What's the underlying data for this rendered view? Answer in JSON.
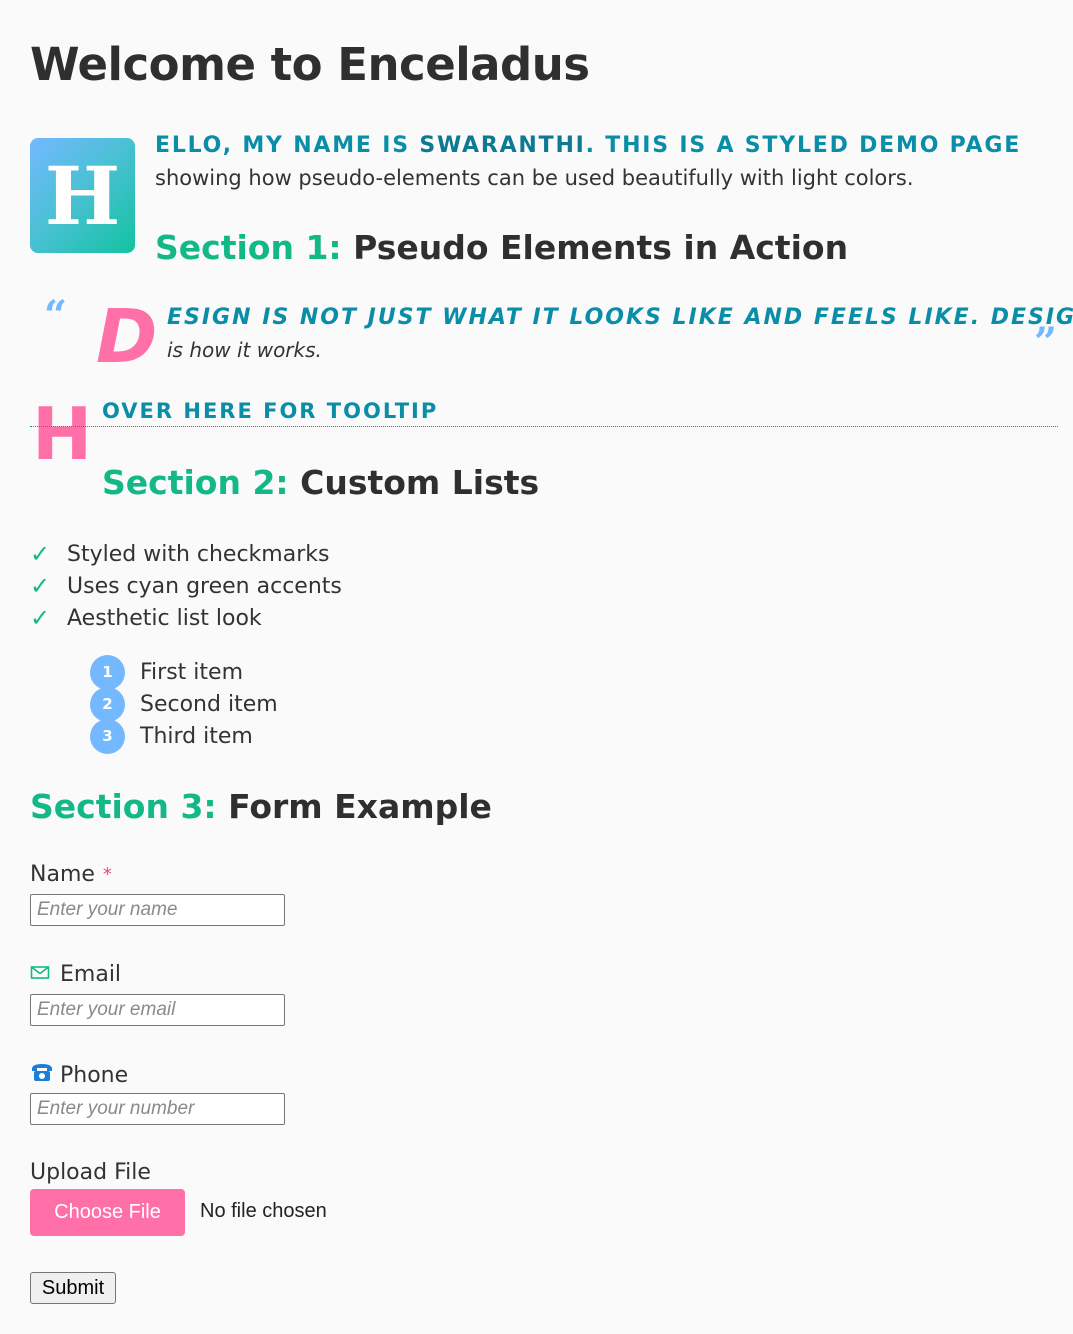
{
  "page": {
    "title": "Welcome to Enceladus"
  },
  "intro": {
    "dropcap": "H",
    "line1_a": "ello, my name is ",
    "line1_name": "Swaranthi",
    "line1_b": ". This is a styled demo page",
    "line2": "showing how pseudo-elements can be used beautifully with light colors."
  },
  "section1": {
    "number": "Section 1:",
    "title": "Pseudo Elements in Action"
  },
  "quote": {
    "open_mark": "“",
    "close_mark": "”",
    "dropcap": "D",
    "line1": "ESIGN IS NOT JUST WHAT IT LOOKS LIKE AND FEELS LIKE. DESIGN",
    "line2": "is how it works."
  },
  "tooltip": {
    "dropcap": "H",
    "text": "OVER HERE FOR TOOLTIP"
  },
  "section2": {
    "number": "Section 2:",
    "title": "Custom Lists"
  },
  "check_list": {
    "mark": "✓",
    "items": [
      "Styled with checkmarks",
      "Uses cyan green accents",
      "Aesthetic list look"
    ]
  },
  "numbered_list": {
    "items": [
      {
        "num": "1",
        "label": "First item"
      },
      {
        "num": "2",
        "label": "Second item"
      },
      {
        "num": "3",
        "label": "Third item"
      }
    ]
  },
  "section3": {
    "number": "Section 3:",
    "title": "Form Example"
  },
  "form": {
    "name_label": "Name",
    "required_mark": "*",
    "name_placeholder": "Enter your name",
    "email_label": "Email",
    "email_icon": "envelope-icon",
    "email_placeholder": "Enter your email",
    "phone_label": "Phone",
    "phone_icon": "telephone-icon",
    "phone_placeholder": "Enter your number",
    "upload_label": "Upload File",
    "choose_button": "Choose File",
    "file_status": "No file chosen",
    "submit_button": "Submit"
  },
  "colors": {
    "accent_green": "#12b886",
    "accent_teal": "#0a8ea8",
    "accent_pink": "#ff6fa8",
    "accent_blue": "#74b9ff"
  }
}
